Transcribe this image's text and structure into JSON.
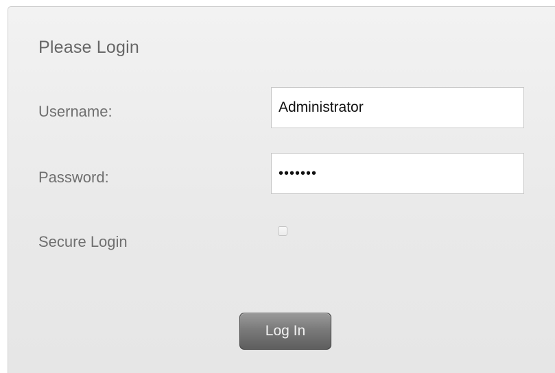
{
  "login": {
    "title": "Please Login",
    "username_label": "Username:",
    "username_value": "Administrator",
    "password_label": "Password:",
    "password_value": "•••••••",
    "secure_login_label": "Secure Login",
    "secure_login_checked": false,
    "button_label": "Log In"
  },
  "colors": {
    "panel_background": "#e9e9e9",
    "label_text": "#6f6f6f",
    "button_background": "#7a7a7a",
    "button_text": "#f2f2f2"
  }
}
